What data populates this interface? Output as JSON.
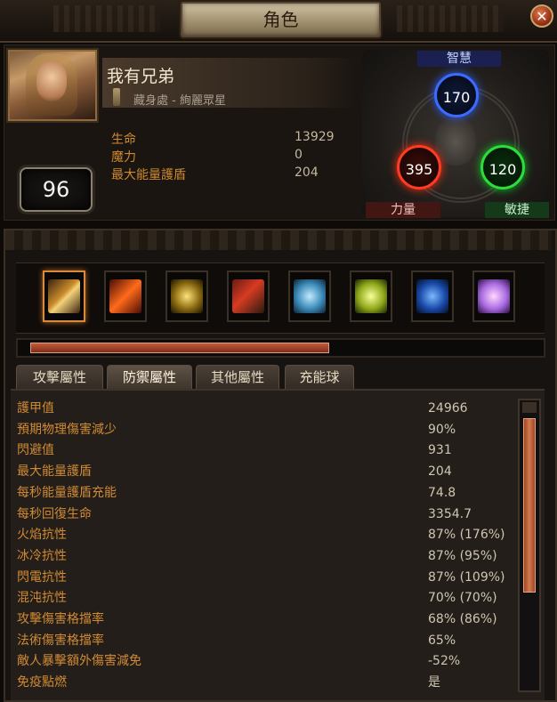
{
  "window": {
    "title": "角色",
    "close_label": "✕"
  },
  "character": {
    "name": "我有兄弟",
    "hideout": "藏身處 - 絢麗眾星",
    "level": "96",
    "stats": [
      {
        "label": "生命",
        "value": "13929"
      },
      {
        "label": "魔力",
        "value": "0"
      },
      {
        "label": "最大能量護盾",
        "value": "204"
      }
    ]
  },
  "attributes": {
    "intelligence": {
      "label": "智慧",
      "value": "170",
      "color": "#3b6cff"
    },
    "strength": {
      "label": "力量",
      "value": "395",
      "color": "#ff3b23"
    },
    "dexterity": {
      "label": "敏捷",
      "value": "120",
      "color": "#2dde3b"
    }
  },
  "skills": [
    {
      "icon": "sword-icon",
      "active": true
    },
    {
      "icon": "fire-slash-icon",
      "active": false
    },
    {
      "icon": "golden-sigil-icon",
      "active": false
    },
    {
      "icon": "shield-charge-icon",
      "active": false
    },
    {
      "icon": "ice-figure-icon",
      "active": false
    },
    {
      "icon": "lightning-figure-icon",
      "active": false
    },
    {
      "icon": "blue-slam-icon",
      "active": false
    },
    {
      "icon": "purple-aura-icon",
      "active": false
    }
  ],
  "progress": {
    "fraction": 0.6
  },
  "tabs": [
    {
      "label": "攻擊屬性",
      "active": false
    },
    {
      "label": "防禦屬性",
      "active": true
    },
    {
      "label": "其他屬性",
      "active": false
    },
    {
      "label": "充能球",
      "active": false
    }
  ],
  "defense_rows": [
    {
      "label": "護甲值",
      "value": "24966"
    },
    {
      "label": "預期物理傷害減少",
      "value": "90%"
    },
    {
      "label": "閃避值",
      "value": "931"
    },
    {
      "label": "最大能量護盾",
      "value": "204"
    },
    {
      "label": "每秒能量護盾充能",
      "value": "74.8"
    },
    {
      "label": "每秒回復生命",
      "value": "3354.7"
    },
    {
      "label": "火焰抗性",
      "value": "87% (176%)"
    },
    {
      "label": "冰冷抗性",
      "value": "87% (95%)"
    },
    {
      "label": "閃電抗性",
      "value": "87% (109%)"
    },
    {
      "label": "混沌抗性",
      "value": "70% (70%)"
    },
    {
      "label": "攻擊傷害格擋率",
      "value": "68% (86%)"
    },
    {
      "label": "法術傷害格擋率",
      "value": "65%"
    },
    {
      "label": "敵人暴擊額外傷害減免",
      "value": "-52%"
    },
    {
      "label": "免疫點燃",
      "value": "是"
    }
  ]
}
